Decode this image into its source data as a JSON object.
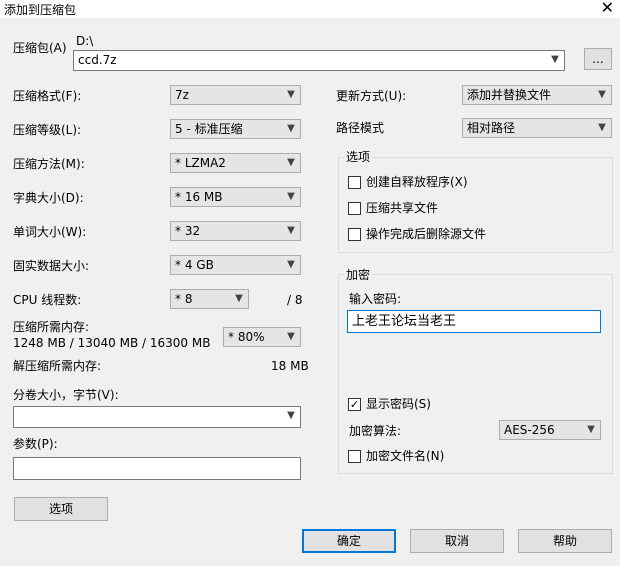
{
  "window": {
    "title": "添加到压缩包",
    "close_glyph": "✕"
  },
  "archive": {
    "label": "压缩包(A)",
    "path": "D:\\",
    "name": "ccd.7z",
    "browse_label": "..."
  },
  "left": {
    "format": {
      "label": "压缩格式(F):",
      "value": "7z"
    },
    "level": {
      "label": "压缩等级(L):",
      "value": "5 - 标准压缩"
    },
    "method": {
      "label": "压缩方法(M):",
      "value": "* LZMA2"
    },
    "dict": {
      "label": "字典大小(D):",
      "value": "* 16 MB"
    },
    "word": {
      "label": "单词大小(W):",
      "value": "* 32"
    },
    "solid": {
      "label": "固实数据大小:",
      "value": "* 4 GB"
    },
    "threads": {
      "label": "CPU 线程数:",
      "value": "* 8",
      "total": "/ 8"
    },
    "mem_compress": {
      "label": "压缩所需内存:",
      "detail": "1248 MB / 13040 MB / 16300 MB",
      "percent": "* 80%"
    },
    "mem_decompress": {
      "label": "解压缩所需内存:",
      "value": "18 MB"
    },
    "volume": {
      "label": "分卷大小，字节(V):",
      "value": ""
    },
    "params": {
      "label": "参数(P):",
      "value": ""
    },
    "options_button": "选项"
  },
  "right": {
    "update": {
      "label": "更新方式(U):",
      "value": "添加并替换文件"
    },
    "pathmode": {
      "label": "路径模式",
      "value": "相对路径"
    },
    "options_group": {
      "title": "选项",
      "sfx": {
        "label": "创建自释放程序(X)",
        "checked": false
      },
      "shared": {
        "label": "压缩共享文件",
        "checked": false
      },
      "delete": {
        "label": "操作完成后删除源文件",
        "checked": false
      }
    },
    "encrypt_group": {
      "title": "加密",
      "password_label": "输入密码:",
      "password_value": "上老王论坛当老王",
      "show_password": {
        "label": "显示密码(S)",
        "checked": true
      },
      "method_label": "加密算法:",
      "method_value": "AES-256",
      "encrypt_names": {
        "label": "加密文件名(N)",
        "checked": false
      }
    }
  },
  "footer": {
    "ok": "确定",
    "cancel": "取消",
    "help": "帮助"
  },
  "icons": {
    "dropdown": "chevron-down-icon",
    "check": "checkmark-icon"
  }
}
